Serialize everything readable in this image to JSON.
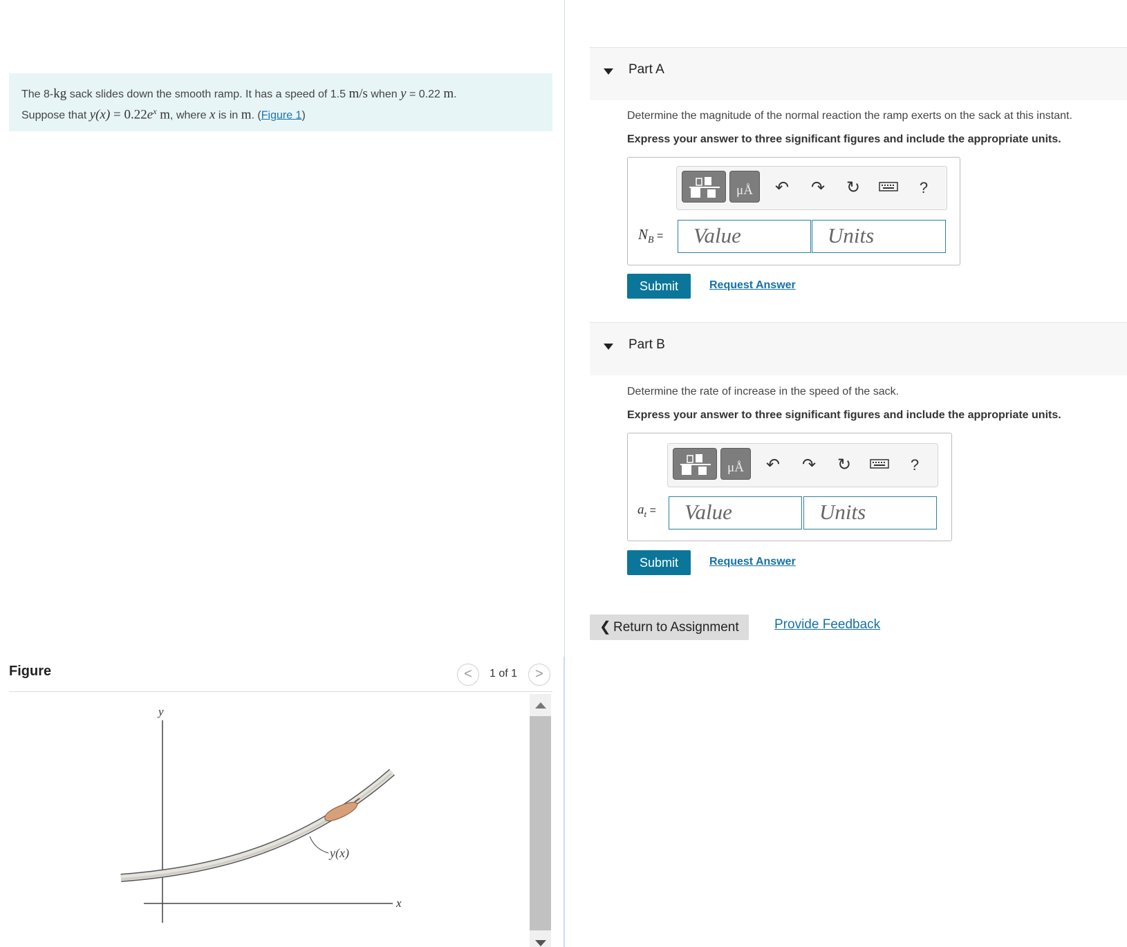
{
  "problem": {
    "t1": "The 8-",
    "kg": "kg",
    "t2": " sack slides down the smooth ramp. It has a speed of 1.5 ",
    "speed_unit": "m/s",
    "t3": " when ",
    "y_var": "y",
    "t4": " = 0.22 ",
    "m1": "m",
    "t5": ".",
    "t6": "Suppose that ",
    "func": "y(x)",
    "eq": " = 0.22",
    "e": "e",
    "exp": "x",
    "m2": " m",
    "t7": ", where ",
    "x_var": "x",
    "t8": " is in ",
    "m3": "m",
    "t9": ". (",
    "figure_link": "Figure 1",
    "t10": ")"
  },
  "figure": {
    "title": "Figure",
    "prev": "<",
    "next": ">",
    "counter": "1 of 1",
    "axis_y": "y",
    "axis_x": "x",
    "curve_label": "y(x)"
  },
  "part_a": {
    "label": "Part A",
    "question": "Determine the magnitude of the normal reaction the ramp exerts on the sack at this instant.",
    "instruction": "Express your answer to three significant figures and include the appropriate units.",
    "lhs_main": "N",
    "lhs_sub": "B",
    "lhs_eq": " =",
    "value_placeholder": "Value",
    "units_placeholder": "Units",
    "units_btn": "μÅ",
    "help": "?",
    "submit": "Submit",
    "request": "Request Answer"
  },
  "part_b": {
    "label": "Part B",
    "question": "Determine the rate of increase in the speed of the sack.",
    "instruction": "Express your answer to three significant figures and include the appropriate units.",
    "lhs_main": "a",
    "lhs_sub": "t",
    "lhs_eq": " =",
    "value_placeholder": "Value",
    "units_placeholder": "Units",
    "units_btn": "μÅ",
    "help": "?",
    "submit": "Submit",
    "request": "Request Answer"
  },
  "footer": {
    "return_chevron": "❮",
    "return": "Return to Assignment",
    "feedback": "Provide Feedback"
  }
}
